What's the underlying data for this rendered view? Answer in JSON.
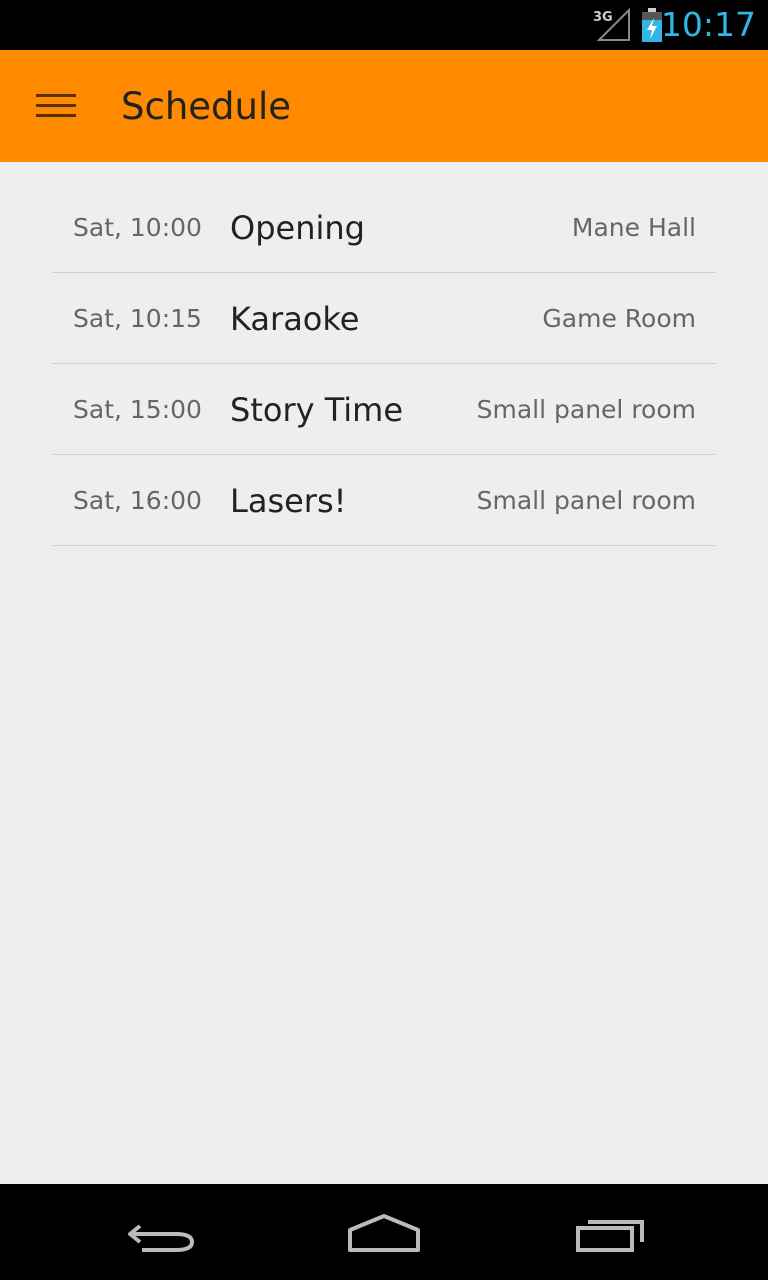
{
  "status_bar": {
    "network_label": "3G",
    "time": "10:17",
    "icons": [
      "signal-icon",
      "battery-charging-icon"
    ]
  },
  "action_bar": {
    "title": "Schedule",
    "menu_icon": "hamburger-menu-icon",
    "background_color": "#ff8a00"
  },
  "schedule": [
    {
      "time": "Sat, 10:00",
      "title": "Opening",
      "room": "Mane Hall"
    },
    {
      "time": "Sat, 10:15",
      "title": "Karaoke",
      "room": "Game Room"
    },
    {
      "time": "Sat, 15:00",
      "title": "Story Time",
      "room": "Small panel room"
    },
    {
      "time": "Sat, 16:00",
      "title": "Lasers!",
      "room": "Small panel room"
    }
  ],
  "nav_bar": {
    "icons": [
      "back-icon",
      "home-icon",
      "recent-apps-icon"
    ]
  },
  "colors": {
    "accent": "#ff8a00",
    "clock": "#33b5e5",
    "background": "#eeeeee",
    "divider": "#cfcfcf"
  }
}
